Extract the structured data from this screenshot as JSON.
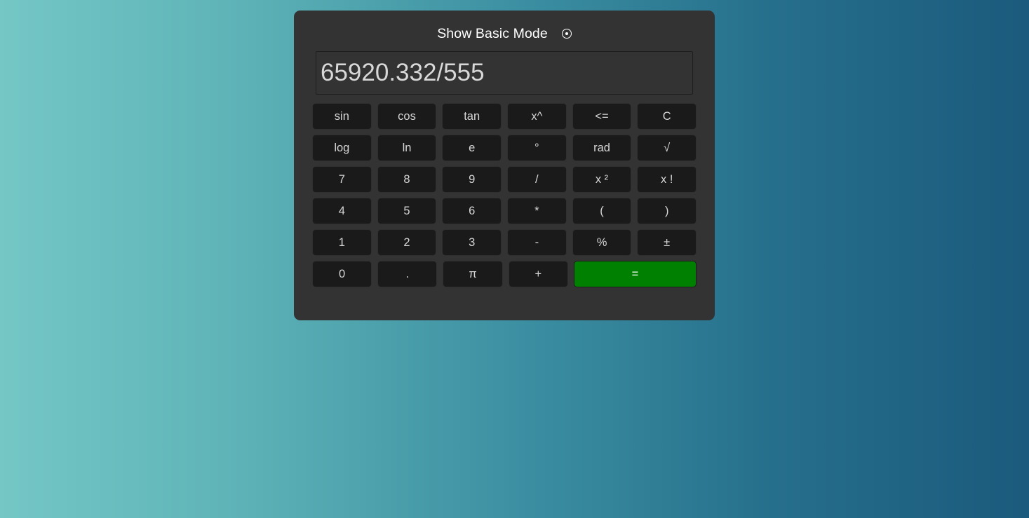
{
  "page": {
    "background_gradient_from": "#74c7c5",
    "background_gradient_to": "#1b5a7c"
  },
  "calculator": {
    "panel_color": "#333333",
    "header": {
      "title": "Show Basic Mode",
      "toggle_icon": "radio-circle-icon"
    },
    "display": {
      "value": "65920.332/555",
      "placeholder": "0"
    },
    "accent_equals_color": "#008000",
    "key_color": "#1a1a1a",
    "rows": [
      [
        {
          "label": "sin",
          "name": "key-sin"
        },
        {
          "label": "cos",
          "name": "key-cos"
        },
        {
          "label": "tan",
          "name": "key-tan"
        },
        {
          "label": "x^",
          "name": "key-power"
        },
        {
          "label": "<=",
          "name": "key-backspace"
        },
        {
          "label": "C",
          "name": "key-clear"
        }
      ],
      [
        {
          "label": "log",
          "name": "key-log"
        },
        {
          "label": "ln",
          "name": "key-ln"
        },
        {
          "label": "e",
          "name": "key-e"
        },
        {
          "label": "°",
          "name": "key-degrees"
        },
        {
          "label": "rad",
          "name": "key-radians"
        },
        {
          "label": "√",
          "name": "key-sqrt"
        }
      ],
      [
        {
          "label": "7",
          "name": "key-7"
        },
        {
          "label": "8",
          "name": "key-8"
        },
        {
          "label": "9",
          "name": "key-9"
        },
        {
          "label": "/",
          "name": "key-divide"
        },
        {
          "label": "x ²",
          "name": "key-square"
        },
        {
          "label": "x !",
          "name": "key-factorial"
        }
      ],
      [
        {
          "label": "4",
          "name": "key-4"
        },
        {
          "label": "5",
          "name": "key-5"
        },
        {
          "label": "6",
          "name": "key-6"
        },
        {
          "label": "*",
          "name": "key-multiply"
        },
        {
          "label": "(",
          "name": "key-open-paren"
        },
        {
          "label": ")",
          "name": "key-close-paren"
        }
      ],
      [
        {
          "label": "1",
          "name": "key-1"
        },
        {
          "label": "2",
          "name": "key-2"
        },
        {
          "label": "3",
          "name": "key-3"
        },
        {
          "label": "-",
          "name": "key-subtract"
        },
        {
          "label": "%",
          "name": "key-percent"
        },
        {
          "label": "±",
          "name": "key-plus-minus"
        }
      ],
      [
        {
          "label": "0",
          "name": "key-0"
        },
        {
          "label": ".",
          "name": "key-decimal"
        },
        {
          "label": "π",
          "name": "key-pi"
        },
        {
          "label": "+",
          "name": "key-add"
        },
        {
          "label": "=",
          "name": "key-equals",
          "equals": true
        }
      ]
    ]
  }
}
